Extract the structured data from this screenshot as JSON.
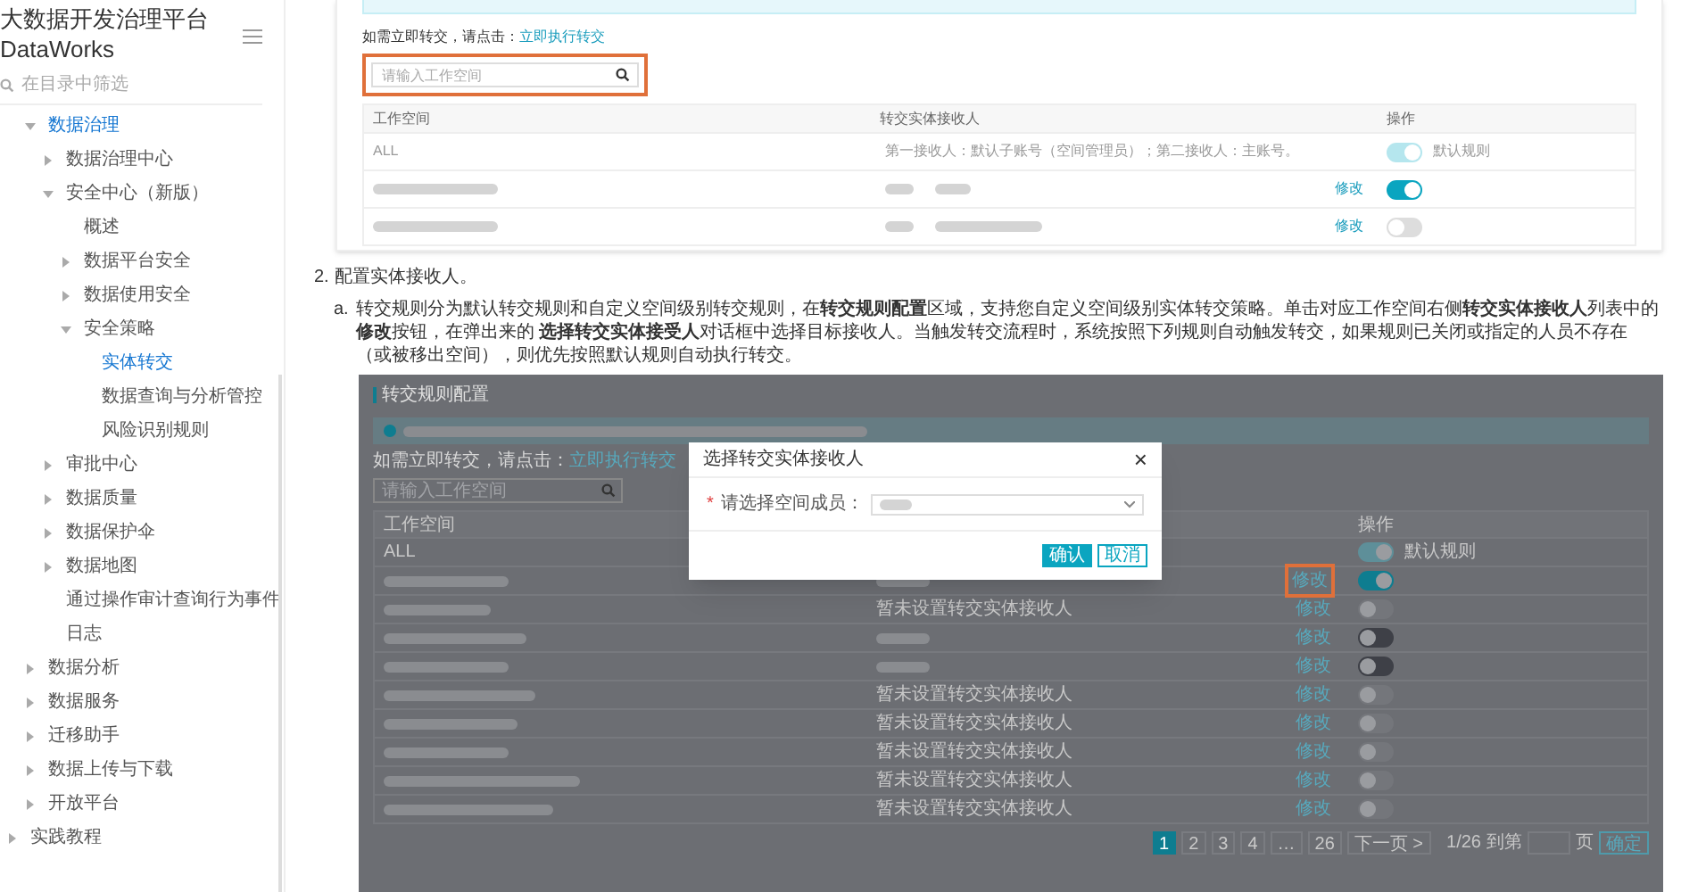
{
  "sidebar": {
    "title": "大数据开发治理平台",
    "subtitle": "DataWorks",
    "search": {
      "placeholder": "在目录中筛选"
    },
    "tree": [
      {
        "label": "数据治理",
        "expanded": true,
        "selected": true,
        "children": [
          {
            "label": "数据治理中心",
            "expanded": false,
            "selected": false
          },
          {
            "label": "安全中心（新版）",
            "expanded": true,
            "selected": false,
            "children": [
              {
                "label": "概述",
                "selected": false
              },
              {
                "label": "数据平台安全",
                "expanded": false,
                "selected": false
              },
              {
                "label": "数据使用安全",
                "expanded": false,
                "selected": false
              },
              {
                "label": "安全策略",
                "expanded": true,
                "selected": false,
                "children": [
                  {
                    "label": "实体转交",
                    "selected": true
                  },
                  {
                    "label": "数据查询与分析管控",
                    "selected": false
                  },
                  {
                    "label": "风险识别规则",
                    "selected": false
                  }
                ]
              }
            ]
          },
          {
            "label": "审批中心",
            "expanded": false,
            "selected": false
          },
          {
            "label": "数据质量",
            "expanded": false,
            "selected": false
          },
          {
            "label": "数据保护伞",
            "expanded": false,
            "selected": false
          },
          {
            "label": "数据地图",
            "expanded": false,
            "selected": false
          },
          {
            "label": "通过操作审计查询行为事件日志",
            "selected": false
          }
        ]
      },
      {
        "label": "数据分析",
        "expanded": false,
        "selected": false
      },
      {
        "label": "数据服务",
        "expanded": false,
        "selected": false
      },
      {
        "label": "迁移助手",
        "expanded": false,
        "selected": false
      },
      {
        "label": "数据上传与下载",
        "expanded": false,
        "selected": false
      },
      {
        "label": "开放平台",
        "expanded": false,
        "selected": false
      }
    ],
    "top_level": [
      {
        "label": "实践教程",
        "expanded": false,
        "selected": false
      }
    ]
  },
  "top_card": {
    "hint": "如需立即转交，请点击：",
    "hint_link": "立即执行转交",
    "search": {
      "placeholder": "请输入工作空间",
      "highlighted": true
    },
    "columns": [
      "工作空间",
      "转交实体接收人",
      "操作"
    ],
    "rows": [
      {
        "kind": "default",
        "workspace": "ALL",
        "receiver": "第一接收人：默认子账号（空间管理员）；第二接收人：主账号。",
        "toggle_on": true,
        "toggle_disabled": true,
        "toggle_label": "默认规则"
      },
      {
        "kind": "custom",
        "action": "修改",
        "toggle_on": true,
        "toggle_disabled": false
      },
      {
        "kind": "custom",
        "action": "修改",
        "toggle_on": false,
        "toggle_disabled": false
      }
    ]
  },
  "step": {
    "number": "2.",
    "title": "配置实体接收人。"
  },
  "substep": {
    "marker": "a.",
    "text": "转交规则分为默认转交规则和自定义空间级别转交规则，在**转交规则配置**区域，支持您自定义空间级别实体转交策略。单击对应工作空间右侧**转交实体接收人**列表中的**修改**按钮，在弹出来的 **选择转交实体接受人**对话框中选择目标接收人。当触发转交流程时，系统按照下列规则自动触发转交，如果规则已关闭或指定的人员不存在（或被移出空间），则优先按照默认规则自动执行转交。"
  },
  "screenshot": {
    "title": "转交规则配置",
    "hint": "如需立即转交，请点击：",
    "hint_link": "立即执行转交",
    "search": {
      "placeholder": "请输入工作空间"
    },
    "column_1": "工作空间",
    "column_3": "操作",
    "rows": [
      {
        "kind": "default",
        "workspace": "ALL",
        "toggle_on": true,
        "toggle_disabled": true,
        "toggle_label": "默认规则"
      },
      {
        "kind": "custom",
        "action": "修改",
        "highlighted": true,
        "toggle_on": true,
        "toggle_disabled": false
      },
      {
        "kind": "custom",
        "receiver": "暂未设置转交实体接收人",
        "action": "修改",
        "toggle_on": false,
        "toggle_disabled": true
      },
      {
        "kind": "custom",
        "action": "修改",
        "toggle_on": false,
        "toggle_disabled": false
      },
      {
        "kind": "custom",
        "action": "修改",
        "toggle_on": false,
        "toggle_disabled": false
      },
      {
        "kind": "custom",
        "receiver": "暂未设置转交实体接收人",
        "action": "修改",
        "toggle_on": false,
        "toggle_disabled": true
      },
      {
        "kind": "custom",
        "receiver": "暂未设置转交实体接收人",
        "action": "修改",
        "toggle_on": false,
        "toggle_disabled": true
      },
      {
        "kind": "custom",
        "receiver": "暂未设置转交实体接收人",
        "action": "修改",
        "toggle_on": false,
        "toggle_disabled": true
      },
      {
        "kind": "custom",
        "receiver": "暂未设置转交实体接收人",
        "action": "修改",
        "toggle_on": false,
        "toggle_disabled": true
      },
      {
        "kind": "custom",
        "receiver": "暂未设置转交实体接收人",
        "action": "修改",
        "toggle_on": false,
        "toggle_disabled": true
      }
    ],
    "pagination": {
      "pages": [
        {
          "label": "1",
          "selected": true
        },
        {
          "label": "2",
          "selected": false
        },
        {
          "label": "3",
          "selected": false
        },
        {
          "label": "4",
          "selected": false
        },
        {
          "label": "…",
          "selected": false
        },
        {
          "label": "26",
          "selected": false
        }
      ],
      "next": "下一页 >",
      "count": "1/26",
      "goto": "到第",
      "unit": "页",
      "confirm": "确定"
    },
    "dialog": {
      "title": "选择转交实体接收人",
      "close": "×",
      "required": "*",
      "label": "请选择空间成员：",
      "buttons": [
        {
          "label": "确认",
          "kind": "primary"
        },
        {
          "label": "取消",
          "kind": "default"
        }
      ]
    }
  }
}
